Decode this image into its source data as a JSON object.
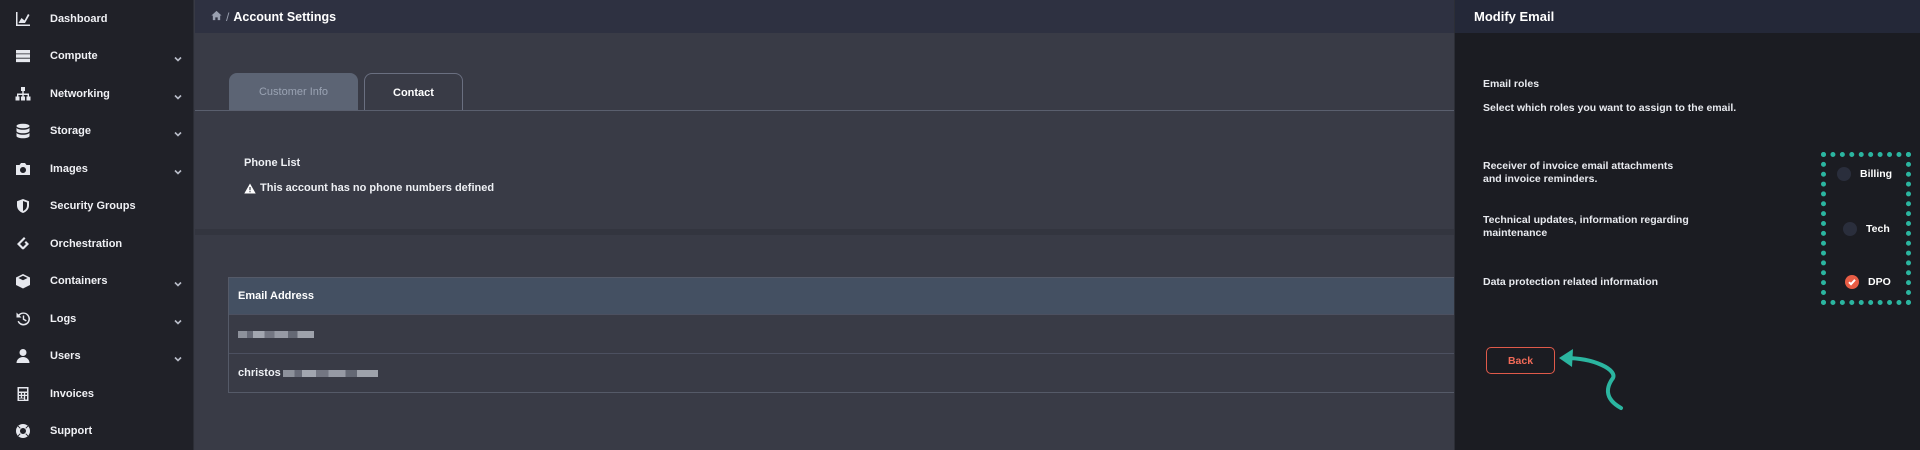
{
  "sidebar": {
    "items": [
      {
        "label": "Dashboard",
        "icon": "chart-area-icon",
        "has_chevron": false
      },
      {
        "label": "Compute",
        "icon": "server-icon",
        "has_chevron": true
      },
      {
        "label": "Networking",
        "icon": "network-icon",
        "has_chevron": true
      },
      {
        "label": "Storage",
        "icon": "database-icon",
        "has_chevron": true
      },
      {
        "label": "Images",
        "icon": "camera-icon",
        "has_chevron": true
      },
      {
        "label": "Security Groups",
        "icon": "shield-icon",
        "has_chevron": false
      },
      {
        "label": "Orchestration",
        "icon": "layers-icon",
        "has_chevron": false
      },
      {
        "label": "Containers",
        "icon": "cube-icon",
        "has_chevron": true
      },
      {
        "label": "Logs",
        "icon": "history-icon",
        "has_chevron": true
      },
      {
        "label": "Users",
        "icon": "user-icon",
        "has_chevron": true
      },
      {
        "label": "Invoices",
        "icon": "calculator-icon",
        "has_chevron": false
      },
      {
        "label": "Support",
        "icon": "lifebuoy-icon",
        "has_chevron": false
      }
    ]
  },
  "breadcrumb": {
    "separator": "/",
    "current": "Account Settings"
  },
  "tabs": [
    {
      "label": "Customer Info",
      "active": false
    },
    {
      "label": "Contact",
      "active": true
    }
  ],
  "phone": {
    "title": "Phone List",
    "warning": "This account has no phone numbers defined"
  },
  "emails": {
    "header": "Email Address",
    "rows": [
      {
        "prefix": ""
      },
      {
        "prefix": "christos"
      }
    ]
  },
  "panel": {
    "title": "Modify Email",
    "section_title": "Email roles",
    "section_sub": "Select which roles you want to assign to the email.",
    "roles": [
      {
        "description": "Receiver of invoice email attachments and invoice reminders.",
        "option": "Billing",
        "checked": false
      },
      {
        "description": "Technical updates, information regarding maintenance",
        "option": "Tech",
        "checked": false
      },
      {
        "description": "Data protection related information",
        "option": "DPO",
        "checked": true
      }
    ],
    "back_label": "Back"
  },
  "colors": {
    "accent": "#e85d45",
    "highlight": "#2bb5a0",
    "sidebar_bg": "#202128",
    "panel_bg": "#1b1c22"
  }
}
